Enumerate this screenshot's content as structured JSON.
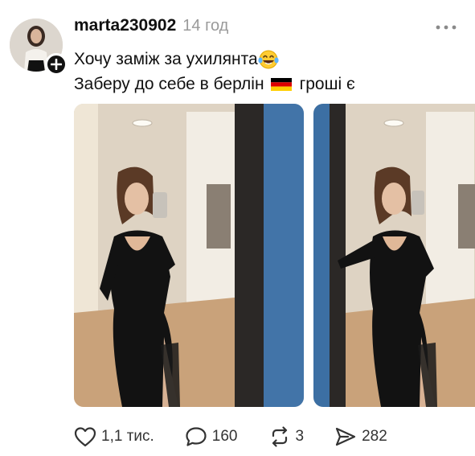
{
  "post": {
    "author": {
      "username": "marta230902",
      "avatar_icon": "avatar-photo",
      "follow_icon": "plus-icon"
    },
    "time_ago": "14 год",
    "more_icon": "more-horizontal-icon",
    "text_lines": [
      {
        "text": "Хочу заміж за ухилянта",
        "emoji_icon": "laughing-tears-emoji"
      },
      {
        "text_before": "Заберу до себе в берлін",
        "flag_icon": "germany-flag",
        "text_after": "гроші є"
      }
    ],
    "media": [
      {
        "icon": "photo-mirror-selfie-1"
      },
      {
        "icon": "photo-mirror-selfie-2"
      }
    ],
    "actions": {
      "like": {
        "icon": "heart-icon",
        "count": "1,1 тис."
      },
      "comment": {
        "icon": "comment-icon",
        "count": "160"
      },
      "repost": {
        "icon": "repost-icon",
        "count": "3"
      },
      "share": {
        "icon": "send-icon",
        "count": "282"
      }
    },
    "colors": {
      "text": "#111111",
      "muted": "#9a9a9a",
      "flag_black": "#000000",
      "flag_red": "#dd0000",
      "flag_gold": "#ffce00"
    }
  }
}
